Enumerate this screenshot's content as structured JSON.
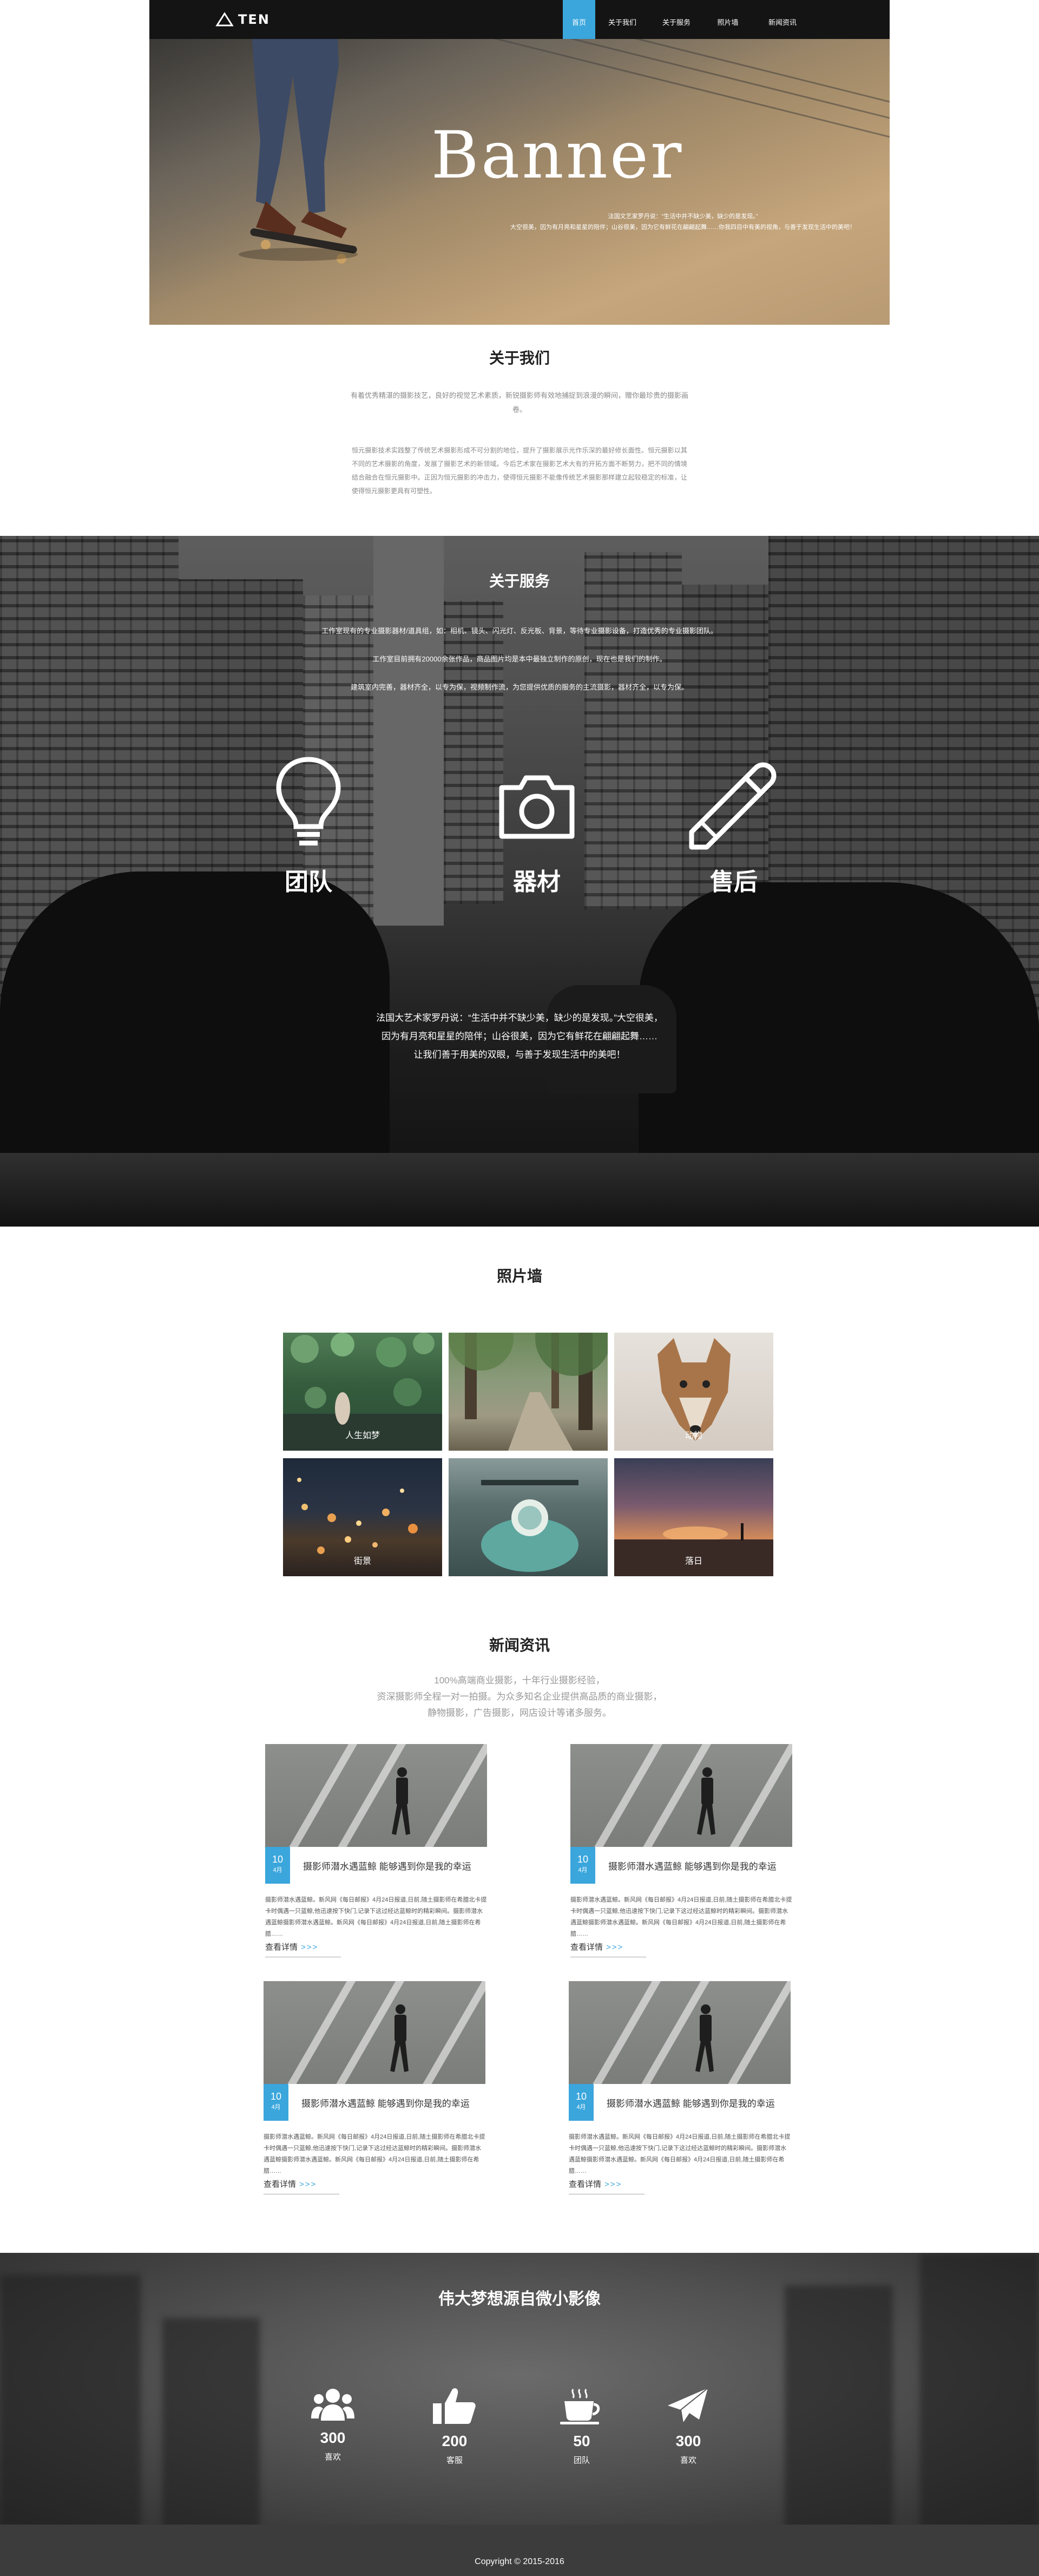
{
  "header": {
    "logo_text": "TEN",
    "nav": [
      {
        "label": "首页",
        "active": true
      },
      {
        "label": "关于我们",
        "active": false
      },
      {
        "label": "关于服务",
        "active": false
      },
      {
        "label": "照片墙",
        "active": false
      },
      {
        "label": "新闻资讯",
        "active": false
      }
    ]
  },
  "banner": {
    "title": "Banner",
    "text": "法国文艺家罗丹说：“生活中并不缺少美，缺少的是发现。”\n大空很美，因为有月亮和星星的陪伴；山谷很美，因为它有鲜花在翩翩起舞……你我四目中有美的视角，与善于发现生活中的美吧！"
  },
  "about": {
    "title": "关于我们",
    "intro": "有着优秀精湛的摄影技艺，良好的视觉艺术素质，新锐摄影师有效地捕捉到浪漫的瞬间，赠你最珍贵的摄影画卷。",
    "body": "恒元摄影技术实践整了传统艺术摄影形成不可分割的地位，提升了摄影展示光作乐深的最好修长面性。恒元摄影以其不同的艺术摄影的角度，发展了摄影艺术的新领域。今后艺术家在摄影艺术大有的开拓方面不断努力，把不同的情境结合融合在恒元摄影中。正因为恒元摄影的冲击力，使得恒元摄影不能像传统艺术摄影那样建立起较稳定的标准，让使得恒元摄影更具有可塑性。"
  },
  "service": {
    "title": "关于服务",
    "lines": [
      "工作室现有的专业摄影器材/道具组，如：相机、镜头、闪光灯、反光板、背景，等待专业摄影设备，打造优秀的专业摄影团队。",
      "工作室目前拥有20000余张作品，商品图片均是本中最独立制作的原创，现在也是我们的制作。",
      "建筑室内完善，器材齐全，以专为保，视频制作流，为您提供优质的服务的主流摄影，器材齐全，以专为保。"
    ],
    "items": [
      {
        "label": "团队",
        "icon": "lightbulb-icon"
      },
      {
        "label": "器材",
        "icon": "camera-icon"
      },
      {
        "label": "售后",
        "icon": "pencil-icon"
      }
    ],
    "quote": [
      "法国大艺术家罗丹说：“生活中并不缺少美，缺少的是发现。”大空很美，",
      "因为有月亮和星星的陪伴；山谷很美，因为它有鲜花在翩翩起舞……",
      "让我们善于用美的双眼，与善于发现生活中的美吧！"
    ]
  },
  "photos": {
    "title": "照片墙",
    "items": [
      {
        "caption": "人生如梦"
      },
      {
        "caption": ""
      },
      {
        "caption": "动物"
      },
      {
        "caption": "街景"
      },
      {
        "caption": ""
      },
      {
        "caption": "落日"
      }
    ]
  },
  "news": {
    "title": "新闻资讯",
    "intro": [
      "100%高端商业摄影，十年行业摄影经验，",
      "资深摄影师全程一对一拍摄。为众多知名企业提供高品质的商业摄影，",
      "静物摄影，广告摄影，网店设计等诸多服务。"
    ],
    "cards": [
      {
        "day": "10",
        "month": "4月",
        "headline": "摄影师潜水遇蓝鲸 能够遇到你是我的幸运",
        "body": "摄影师潜水遇蓝鲸。新风网《每日邮报》4月24日报道,日前,随土摄影师在希腊北卡提卡时偶遇一只蓝鲸,他迅速按下快门,记录下这过经达蓝鲸时的精彩瞬间。摄影师潜水遇蓝鲸摄影师潜水遇蓝鲸。新风网《每日邮报》4月24日报道,日前,随土摄影师在希腊……",
        "more": "查看详情",
        "arrows": ">>>"
      },
      {
        "day": "10",
        "month": "4月",
        "headline": "摄影师潜水遇蓝鲸 能够遇到你是我的幸运",
        "body": "摄影师潜水遇蓝鲸。新风网《每日邮报》4月24日报道,日前,随土摄影师在希腊北卡提卡时偶遇一只蓝鲸,他迅速按下快门,记录下这过经达蓝鲸时的精彩瞬间。摄影师潜水遇蓝鲸摄影师潜水遇蓝鲸。新风网《每日邮报》4月24日报道,日前,随土摄影师在希腊……",
        "more": "查看详情",
        "arrows": ">>>"
      },
      {
        "day": "10",
        "month": "4月",
        "headline": "摄影师潜水遇蓝鲸 能够遇到你是我的幸运",
        "body": "摄影师潜水遇蓝鲸。新风网《每日邮报》4月24日报道,日前,随土摄影师在希腊北卡提卡时偶遇一只蓝鲸,他迅速按下快门,记录下这过经达蓝鲸时的精彩瞬间。摄影师潜水遇蓝鲸摄影师潜水遇蓝鲸。新风网《每日邮报》4月24日报道,日前,随土摄影师在希腊……",
        "more": "查看详情",
        "arrows": ">>>"
      },
      {
        "day": "10",
        "month": "4月",
        "headline": "摄影师潜水遇蓝鲸 能够遇到你是我的幸运",
        "body": "摄影师潜水遇蓝鲸。新风网《每日邮报》4月24日报道,日前,随土摄影师在希腊北卡提卡时偶遇一只蓝鲸,他迅速按下快门,记录下这过经达蓝鲸时的精彩瞬间。摄影师潜水遇蓝鲸摄影师潜水遇蓝鲸。新风网《每日邮报》4月24日报道,日前,随土摄影师在希腊……",
        "more": "查看详情",
        "arrows": ">>>"
      }
    ]
  },
  "dream": {
    "title": "伟大梦想源自微小影像",
    "stats": [
      {
        "num": "300",
        "label": "喜欢",
        "icon": "users-icon"
      },
      {
        "num": "200",
        "label": "客服",
        "icon": "thumbs-up-icon"
      },
      {
        "num": "50",
        "label": "团队",
        "icon": "coffee-cup-icon"
      },
      {
        "num": "300",
        "label": "喜欢",
        "icon": "paper-plane-icon"
      }
    ]
  },
  "footer": {
    "copyright": "Copyright © 2015-2016"
  },
  "colors": {
    "accent": "#3aa6dc",
    "nav_bg": "#141414",
    "footer_bg": "#3c3c3c"
  }
}
